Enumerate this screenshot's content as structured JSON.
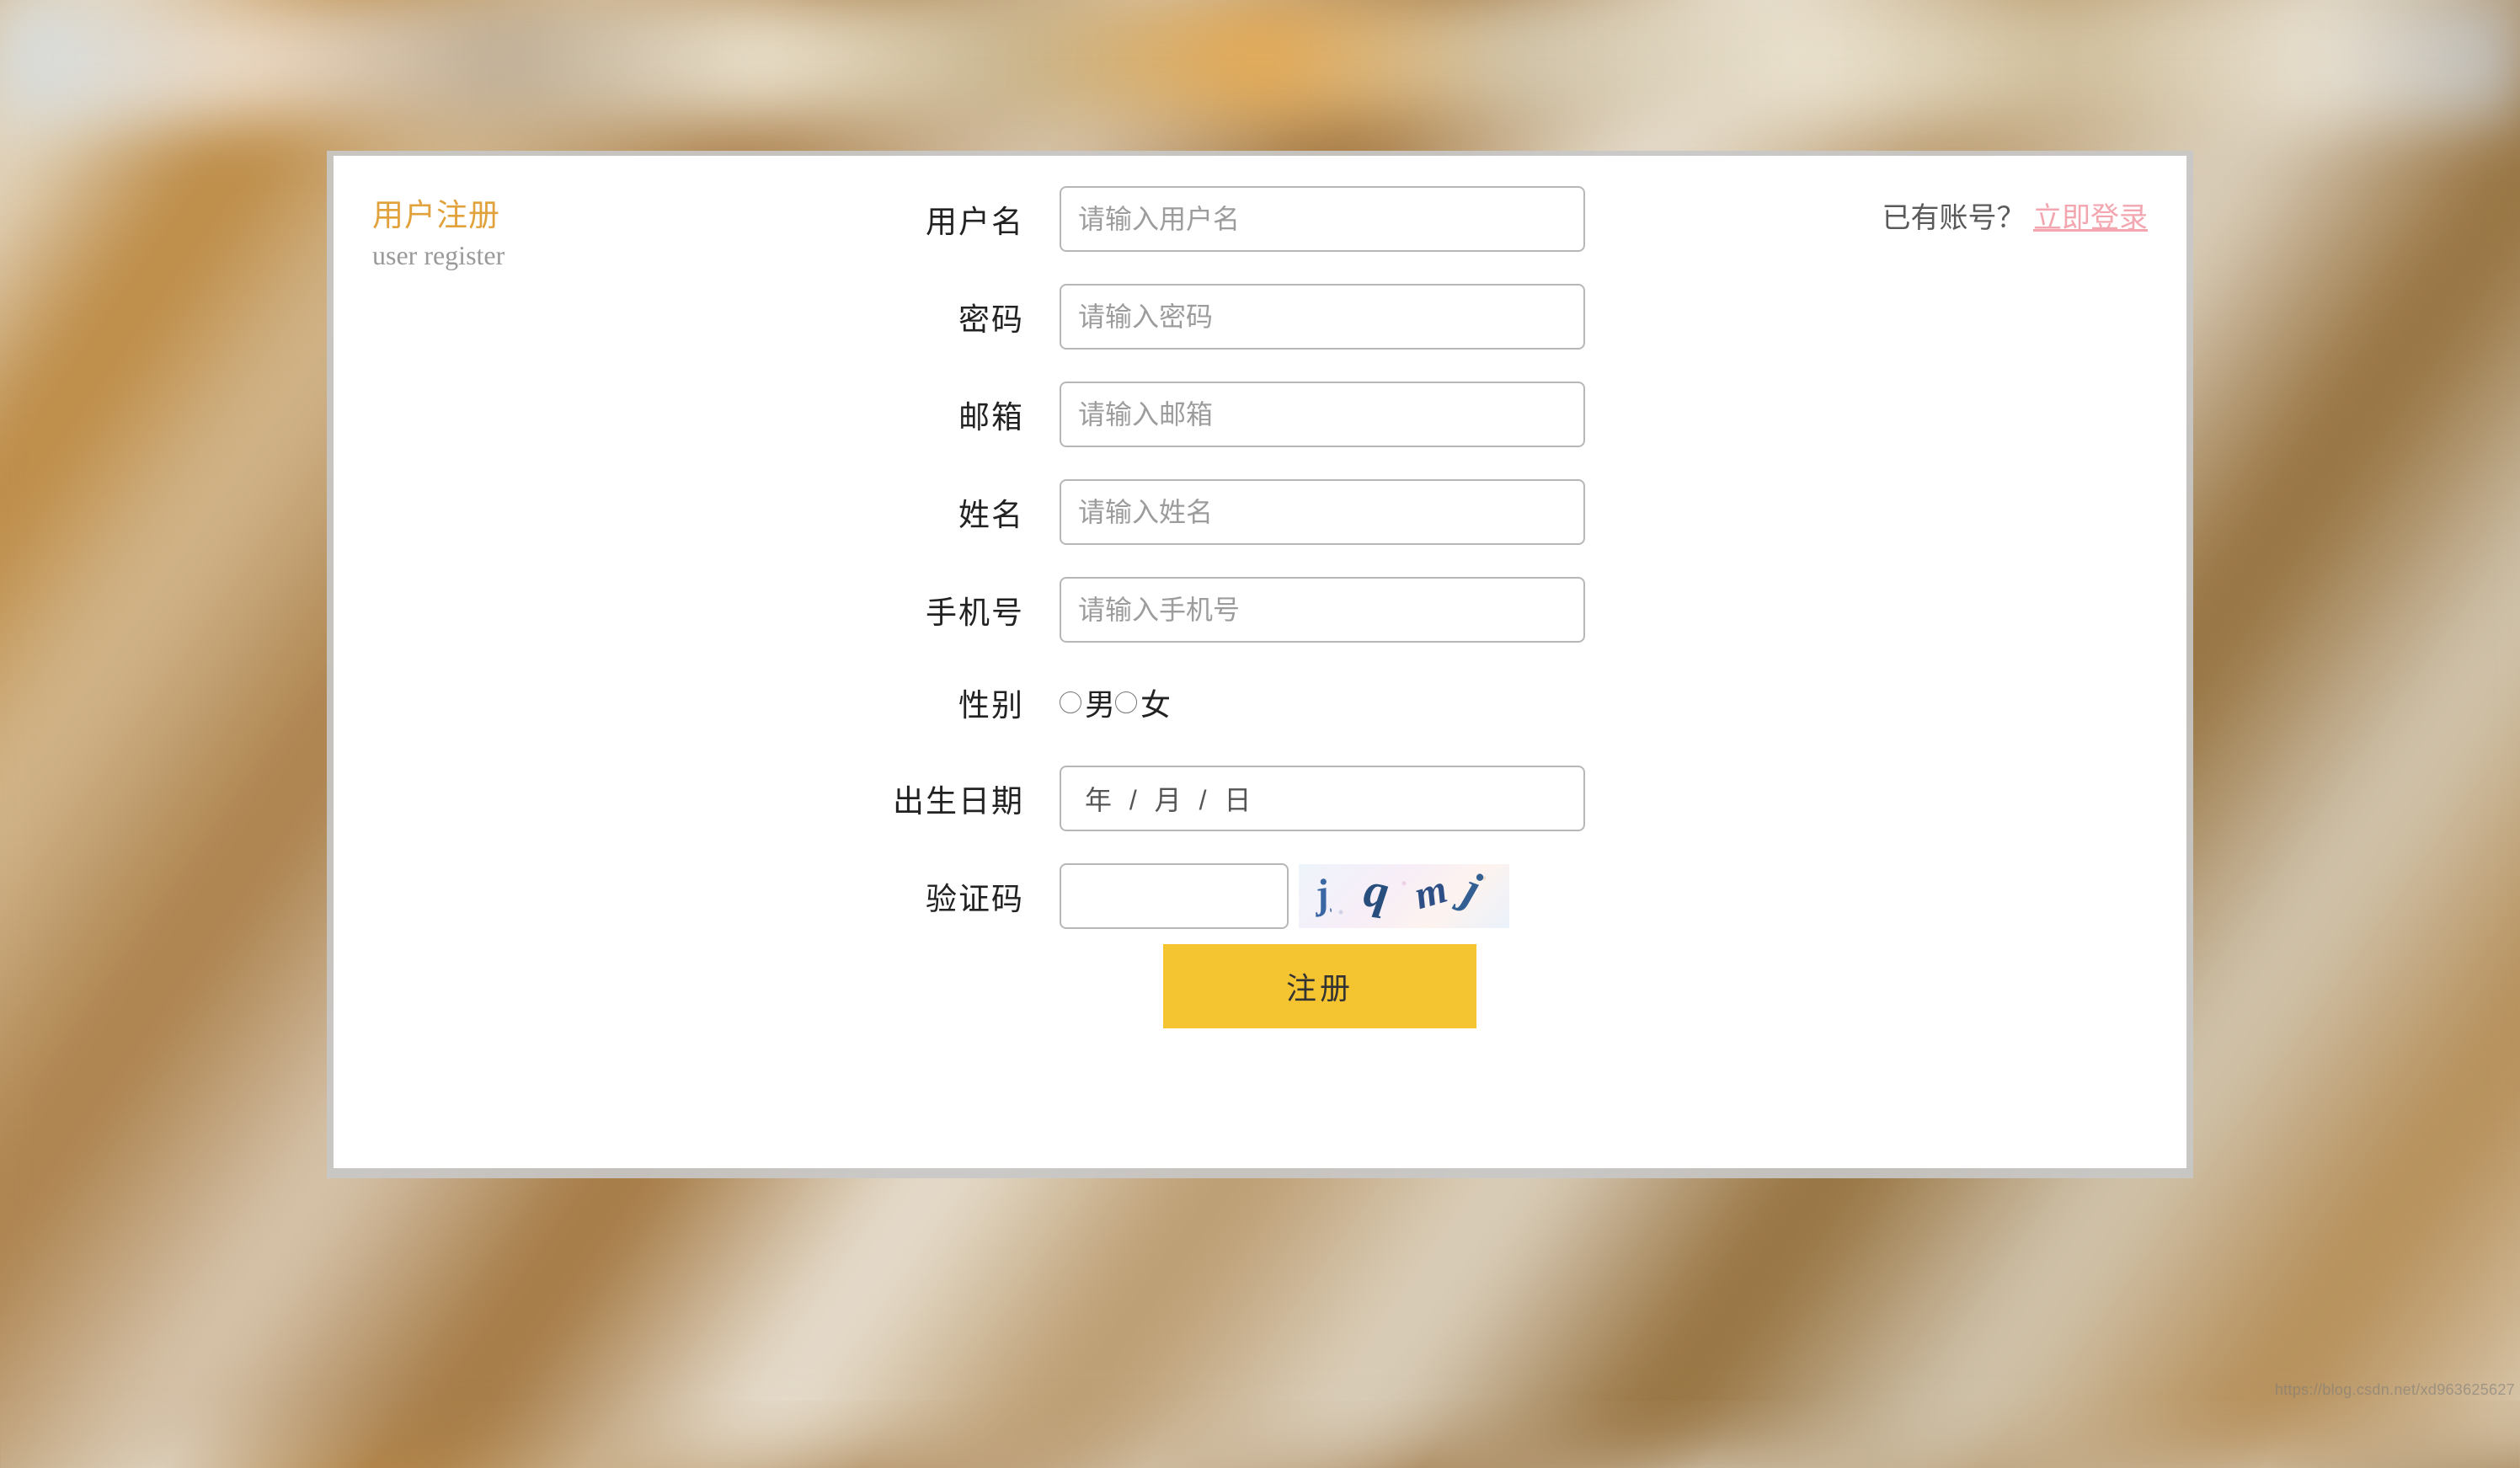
{
  "sideTitle": {
    "zh": "用户注册",
    "en": "user register"
  },
  "loginHint": {
    "prefix": "已有账号？",
    "link": "立即登录"
  },
  "form": {
    "username": {
      "label": "用户名",
      "placeholder": "请输入用户名",
      "value": ""
    },
    "password": {
      "label": "密码",
      "placeholder": "请输入密码",
      "value": ""
    },
    "email": {
      "label": "邮箱",
      "placeholder": "请输入邮箱",
      "value": ""
    },
    "realname": {
      "label": "姓名",
      "placeholder": "请输入姓名",
      "value": ""
    },
    "phone": {
      "label": "手机号",
      "placeholder": "请输入手机号",
      "value": ""
    },
    "gender": {
      "label": "性别",
      "options": {
        "male": "男",
        "female": "女"
      },
      "selected": ""
    },
    "birthday": {
      "label": "出生日期",
      "display": "年  / 月 / 日"
    },
    "captcha": {
      "label": "验证码",
      "value": "",
      "imageText": "jqmj"
    },
    "submit": "注册"
  },
  "watermark": "https://blog.csdn.net/xd963625627"
}
